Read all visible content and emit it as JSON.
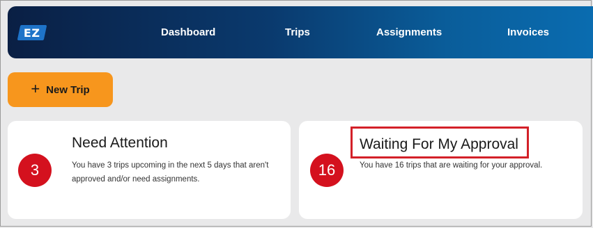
{
  "logo": {
    "text": "EZ"
  },
  "nav": {
    "items": [
      {
        "label": "Dashboard"
      },
      {
        "label": "Trips"
      },
      {
        "label": "Assignments"
      },
      {
        "label": "Invoices"
      }
    ]
  },
  "actions": {
    "new_trip_label": "New Trip",
    "new_trip_icon": "plus-icon"
  },
  "cards": [
    {
      "count": "3",
      "title": "Need Attention",
      "description": "You have 3 trips upcoming in the next 5 days that aren't approved and/or need assignments."
    },
    {
      "count": "16",
      "title": "Waiting For My Approval",
      "description": "You have 16 trips that are waiting for your approval."
    }
  ],
  "colors": {
    "accent_orange": "#f7961d",
    "badge_red": "#d4111e",
    "highlight_red": "#d32028",
    "nav_dark": "#0a1f44",
    "nav_light": "#0a6cb0"
  }
}
